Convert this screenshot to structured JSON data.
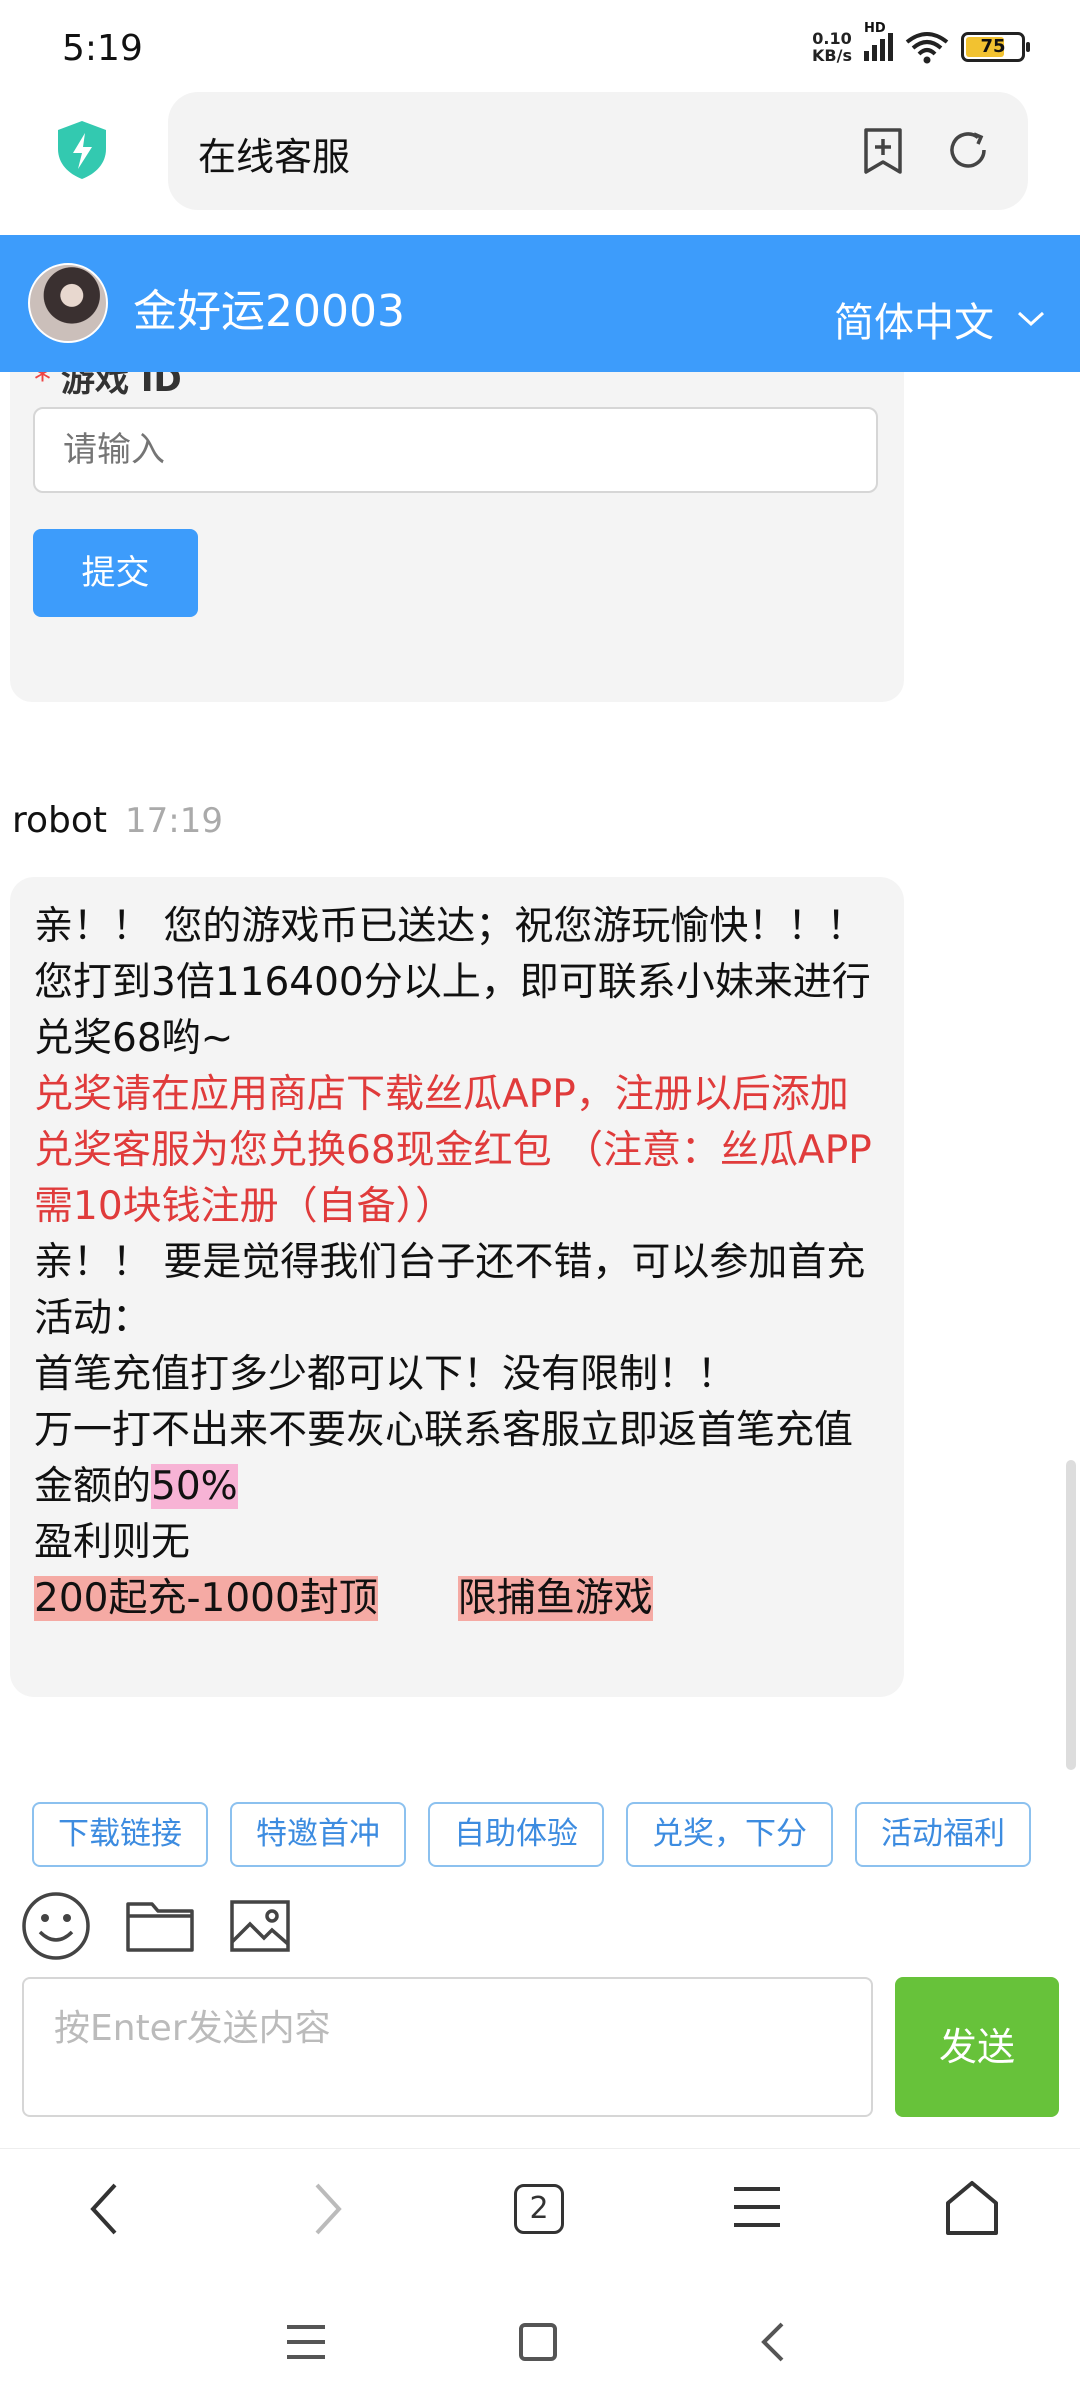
{
  "status": {
    "time": "5:19",
    "netspeed_value": "0.10",
    "netspeed_unit": "KB/s",
    "net_type": "HD",
    "battery": "75"
  },
  "browser": {
    "title": "在线客服"
  },
  "header": {
    "agent_name": "金好运20003",
    "language": "简体中文"
  },
  "form": {
    "field_label": "游戏 ID",
    "required_mark": "*",
    "placeholder": "请输入",
    "submit": "提交"
  },
  "message": {
    "sender": "robot",
    "time": "17:19",
    "lines": {
      "l1": "亲！！ 您的游戏币已送达；祝您游玩愉快！！！",
      "l2": "您打到3倍116400分以上，即可联系小妹来进行兑奖68哟~",
      "l3": "兑奖请在应用商店下载丝瓜APP，注册以后添加兑奖客服为您兑换68现金红包 （注意：丝瓜APP需10块钱注册（自备））",
      "l4": "亲！！ 要是觉得我们台子还不错，可以参加首充活动：",
      "l5": "首笔充值打多少都可以下！没有限制！！",
      "l6a": "万一打不出来不要灰心联系客服立即返首笔充值金额的",
      "l6b": "50%",
      "l7": "盈利则无",
      "l8a": "200起充-1000封顶",
      "l8b": "限捕鱼游戏"
    }
  },
  "chips": [
    "下载链接",
    "特邀首冲",
    "自助体验",
    "兑奖，下分",
    "活动福利"
  ],
  "composer": {
    "placeholder": "按Enter发送内容",
    "send": "发送"
  },
  "nav": {
    "tabs": "2"
  },
  "colors": {
    "header_blue": "#3d9cfb",
    "send_green": "#67c23a",
    "notice_red": "#e03b3b"
  }
}
